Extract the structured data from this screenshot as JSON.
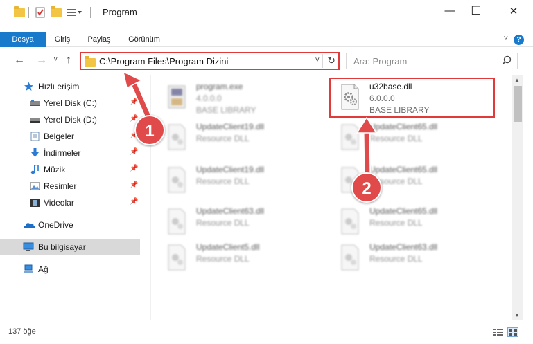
{
  "window": {
    "title": "Program",
    "minimize_glyph": "—",
    "maximize_glyph": "☐",
    "close_glyph": "✕"
  },
  "ribbon": {
    "tabs": [
      "Dosya",
      "Giriş",
      "Paylaş",
      "Görünüm"
    ],
    "help_glyph": "?",
    "collapse_glyph": "˅"
  },
  "nav": {
    "back_glyph": "←",
    "forward_glyph": "→",
    "recent_glyph": "˅",
    "up_glyph": "↑"
  },
  "address": {
    "path": "C:\\Program Files\\Program Dizini",
    "dropdown_glyph": "˅",
    "refresh_glyph": "↻"
  },
  "search": {
    "placeholder": "Ara: Program",
    "icon_glyph": "⚲"
  },
  "sidebar": {
    "items": [
      {
        "label": "Hızlı erişim",
        "icon": "star-icon",
        "pinned": false
      },
      {
        "label": "Yerel Disk (C:)",
        "icon": "drive-icon",
        "pinned": true
      },
      {
        "label": "Yerel Disk (D:)",
        "icon": "drive-icon",
        "pinned": true
      },
      {
        "label": "Belgeler",
        "icon": "documents-icon",
        "pinned": true
      },
      {
        "label": "İndirmeler",
        "icon": "download-icon",
        "pinned": true
      },
      {
        "label": "Müzik",
        "icon": "music-icon",
        "pinned": true
      },
      {
        "label": "Resimler",
        "icon": "pictures-icon",
        "pinned": true
      },
      {
        "label": "Videolar",
        "icon": "video-icon",
        "pinned": true
      },
      {
        "label": "OneDrive",
        "icon": "cloud-icon",
        "pinned": false
      },
      {
        "label": "Bu bilgisayar",
        "icon": "computer-icon",
        "pinned": false,
        "selected": true
      },
      {
        "label": "Ağ",
        "icon": "network-icon",
        "pinned": false
      }
    ],
    "pin_glyph": "📌"
  },
  "files": {
    "left": [
      {
        "name": "program.exe",
        "sub1": "4.0.0.0",
        "sub2": "BASE LIBRARY"
      },
      {
        "name": "UpdateClient19.dll",
        "sub1": "Resource DLL"
      },
      {
        "name": "UpdateClient19.dll",
        "sub1": "Resource DLL"
      },
      {
        "name": "UpdateClient63.dll",
        "sub1": "Resource DLL"
      },
      {
        "name": "UpdateClient5.dll",
        "sub1": "Resource DLL"
      }
    ],
    "right": [
      {
        "name": "u32base.dll",
        "sub1": "6.0.0.0",
        "sub2": "BASE LIBRARY"
      },
      {
        "name": "UpdateClient65.dll",
        "sub1": "Resource DLL"
      },
      {
        "name": "UpdateClient65.dll",
        "sub1": "Resource DLL"
      },
      {
        "name": "UpdateClient65.dll",
        "sub1": "Resource DLL"
      },
      {
        "name": "UpdateClient63.dll",
        "sub1": "Resource DLL"
      }
    ]
  },
  "status": {
    "count": "137 öğe"
  },
  "annotations": {
    "badge1": "1",
    "badge2": "2",
    "color": "#e04a4a"
  },
  "colors": {
    "accent": "#1979ca",
    "highlight": "#e03a3a",
    "selected_bg": "#d9d9d9"
  }
}
